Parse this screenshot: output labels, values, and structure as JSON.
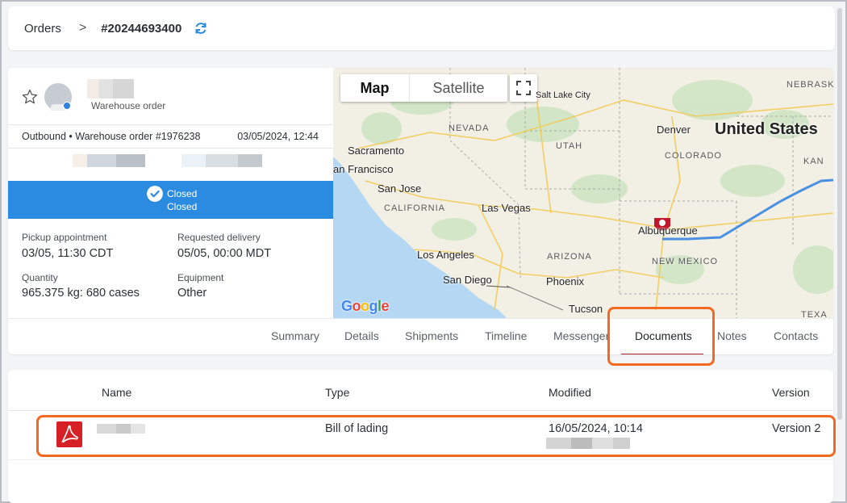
{
  "breadcrumb": {
    "parent": "Orders",
    "separator": ">",
    "current": "#20244693400"
  },
  "order": {
    "type_label": "Warehouse order",
    "meta_left": "Outbound • Warehouse order #1976238",
    "meta_right": "03/05/2024, 12:44",
    "status_line1": "Closed",
    "status_line2": "Closed",
    "fields": {
      "pickup_label": "Pickup appointment",
      "pickup_value": "03/05, 11:30 CDT",
      "delivery_label": "Requested delivery",
      "delivery_value": "05/05, 00:00 MDT",
      "quantity_label": "Quantity",
      "quantity_value": "965.375 kg: 680 cases",
      "equipment_label": "Equipment",
      "equipment_value": "Other"
    }
  },
  "map": {
    "map_button": "Map",
    "satellite_button": "Satellite",
    "google_logo": "Google",
    "labels": {
      "salt_lake": "Salt Lake City",
      "nevada": "NEVADA",
      "denver": "Denver",
      "united_states": "United States",
      "nebraska": "NEBRASK",
      "sacramento": "Sacramento",
      "utah": "UTAH",
      "colorado": "COLORADO",
      "kan": "KAN",
      "san_francisco": "an Francisco",
      "san_jose": "San Jose",
      "california": "CALIFORNIA",
      "las_vegas": "Las Vegas",
      "albuquerque": "Albuquerque",
      "los_angeles": "Los Angeles",
      "arizona": "ARIZONA",
      "new_mexico": "NEW MEXICO",
      "phoenix": "Phoenix",
      "san_diego": "San Diego",
      "tucson": "Tucson",
      "texas": "TEXA"
    },
    "colors": {
      "water": "#b4d7f4",
      "land": "#f2efe4",
      "route": "#4a90e2",
      "marker": "#c0182a"
    }
  },
  "tabs": [
    {
      "label": "Summary",
      "active": false
    },
    {
      "label": "Details",
      "active": false
    },
    {
      "label": "Shipments",
      "active": false
    },
    {
      "label": "Timeline",
      "active": false
    },
    {
      "label": "Messenger",
      "active": false
    },
    {
      "label": "Documents",
      "active": true
    },
    {
      "label": "Notes",
      "active": false
    },
    {
      "label": "Contacts",
      "active": false
    }
  ],
  "documents": {
    "headers": [
      "Name",
      "Type",
      "Modified",
      "Version"
    ],
    "rows": [
      {
        "icon": "pdf-icon",
        "type": "Bill of lading",
        "modified": "16/05/2024, 10:14",
        "version": "Version 2"
      }
    ]
  },
  "accent_colors": {
    "status_bar": "#2a8be0",
    "highlight": "#f26a21",
    "active_tab_underline": "#b3202a"
  }
}
